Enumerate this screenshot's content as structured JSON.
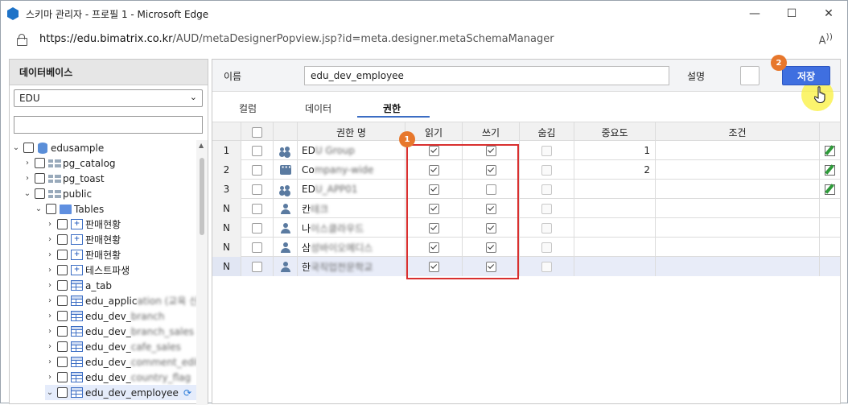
{
  "window": {
    "title": "스키마 관리자 - 프로필 1 - Microsoft Edge",
    "minimize": "—",
    "maximize": "☐",
    "close": "✕"
  },
  "address": {
    "url_prefix": "https://edu.bimatrix.co.kr",
    "url_path": "/AUD/metaDesignerPopview.jsp?id=meta.designer.metaSchemaManager",
    "read_aloud": "A)"
  },
  "left_panel": {
    "header": "데이터베이스",
    "db_select": "EDU",
    "tree": [
      {
        "label": "edusample",
        "blur": "",
        "type": "db",
        "toggle": "⌄",
        "level": 0
      },
      {
        "label": "pg_catalog",
        "blur": "",
        "type": "schema",
        "toggle": "›",
        "level": 1
      },
      {
        "label": "pg_toast",
        "blur": "",
        "type": "schema",
        "toggle": "›",
        "level": 1
      },
      {
        "label": "public",
        "blur": "",
        "type": "schema",
        "toggle": "⌄",
        "level": 1
      },
      {
        "label": "Tables",
        "blur": "",
        "type": "folder",
        "toggle": "⌄",
        "level": 2
      },
      {
        "label": "판매현황",
        "blur": "",
        "type": "view",
        "toggle": "›",
        "level": 3
      },
      {
        "label": "판매현황",
        "blur": "",
        "type": "view",
        "toggle": "›",
        "level": 3
      },
      {
        "label": "판매현황",
        "blur": "",
        "type": "view",
        "toggle": "›",
        "level": 3
      },
      {
        "label": "테스트파생",
        "blur": "",
        "type": "view",
        "toggle": "›",
        "level": 3
      },
      {
        "label": "a_tab",
        "blur": "",
        "type": "table",
        "toggle": "›",
        "level": 3
      },
      {
        "label": "edu_applic",
        "blur": "ation (교육 신",
        "type": "table",
        "toggle": "›",
        "level": 3
      },
      {
        "label": "edu_dev_",
        "blur": "branch",
        "type": "table",
        "toggle": "›",
        "level": 3
      },
      {
        "label": "edu_dev_",
        "blur": "branch_sales",
        "type": "table",
        "toggle": "›",
        "level": 3
      },
      {
        "label": "edu_dev_",
        "blur": "cafe_sales",
        "type": "table",
        "toggle": "›",
        "level": 3
      },
      {
        "label": "edu_dev_",
        "blur": "comment_edit",
        "type": "table",
        "toggle": "›",
        "level": 3
      },
      {
        "label": "edu_dev_",
        "blur": "country_flag",
        "type": "table",
        "toggle": "›",
        "level": 3
      },
      {
        "label": "edu_dev_employee",
        "blur": "",
        "type": "table",
        "toggle": "⌄",
        "level": 3,
        "selected": true
      }
    ]
  },
  "form": {
    "name_label": "이름",
    "name_value": "edu_dev_employee",
    "desc_label": "설명",
    "save_label": "저장",
    "badge_save": "2",
    "badge_cols": "1"
  },
  "tabs": [
    "컬럼",
    "데이터",
    "권한"
  ],
  "active_tab": "권한",
  "grid": {
    "headers": {
      "name": "권한 명",
      "read": "읽기",
      "write": "쓰기",
      "hide": "숨김",
      "importance": "중요도",
      "condition": "조건"
    },
    "rows": [
      {
        "no": "1",
        "icon": "group",
        "name_visible": "ED",
        "name_blur": "U Group",
        "read": true,
        "write": true,
        "importance": "1",
        "edit": true
      },
      {
        "no": "2",
        "icon": "chat",
        "name_visible": "Co",
        "name_blur": "mpany-wide",
        "read": true,
        "write": true,
        "importance": "2",
        "edit": true
      },
      {
        "no": "3",
        "icon": "group",
        "name_visible": "ED",
        "name_blur": "U_APP01",
        "read": true,
        "write": false,
        "importance": "",
        "edit": true
      },
      {
        "no": "N",
        "icon": "person",
        "name_visible": "칸",
        "name_blur": "테크",
        "read": true,
        "write": true,
        "importance": "",
        "edit": false
      },
      {
        "no": "N",
        "icon": "person",
        "name_visible": "나",
        "name_blur": "이스클라우드",
        "read": true,
        "write": true,
        "importance": "",
        "edit": false
      },
      {
        "no": "N",
        "icon": "person",
        "name_visible": "삼",
        "name_blur": "성바이오메디스",
        "read": true,
        "write": true,
        "importance": "",
        "edit": false
      },
      {
        "no": "N",
        "icon": "person",
        "name_visible": "한",
        "name_blur": "국직업전문학교",
        "read": true,
        "write": true,
        "importance": "",
        "edit": false
      }
    ]
  }
}
